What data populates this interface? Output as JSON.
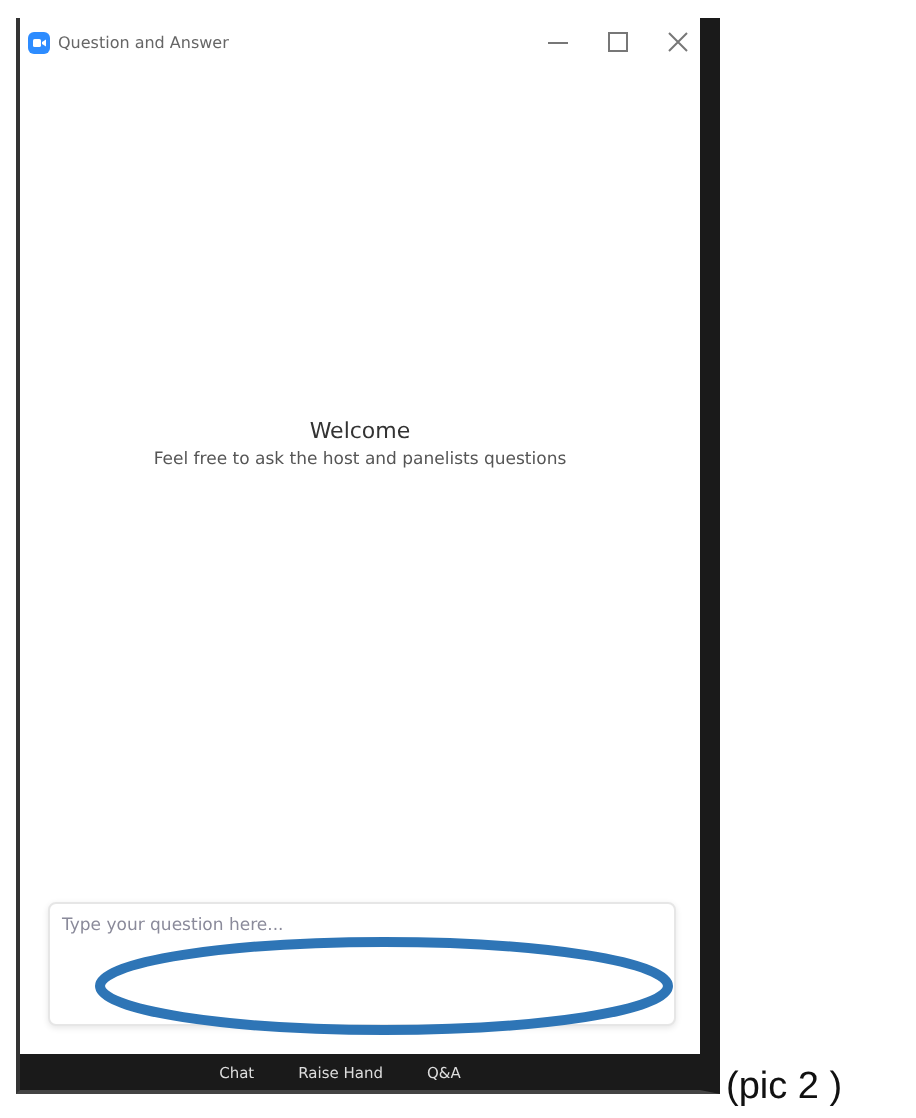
{
  "window": {
    "title": "Question and Answer"
  },
  "welcome": {
    "heading": "Welcome",
    "subtitle": "Feel free to ask the host and panelists questions"
  },
  "question_field": {
    "placeholder": "Type your question here..."
  },
  "toolbar": [
    {
      "label": "Chat"
    },
    {
      "label": "Raise Hand"
    },
    {
      "label": "Q&A"
    }
  ],
  "caption": "(pic 2 )"
}
